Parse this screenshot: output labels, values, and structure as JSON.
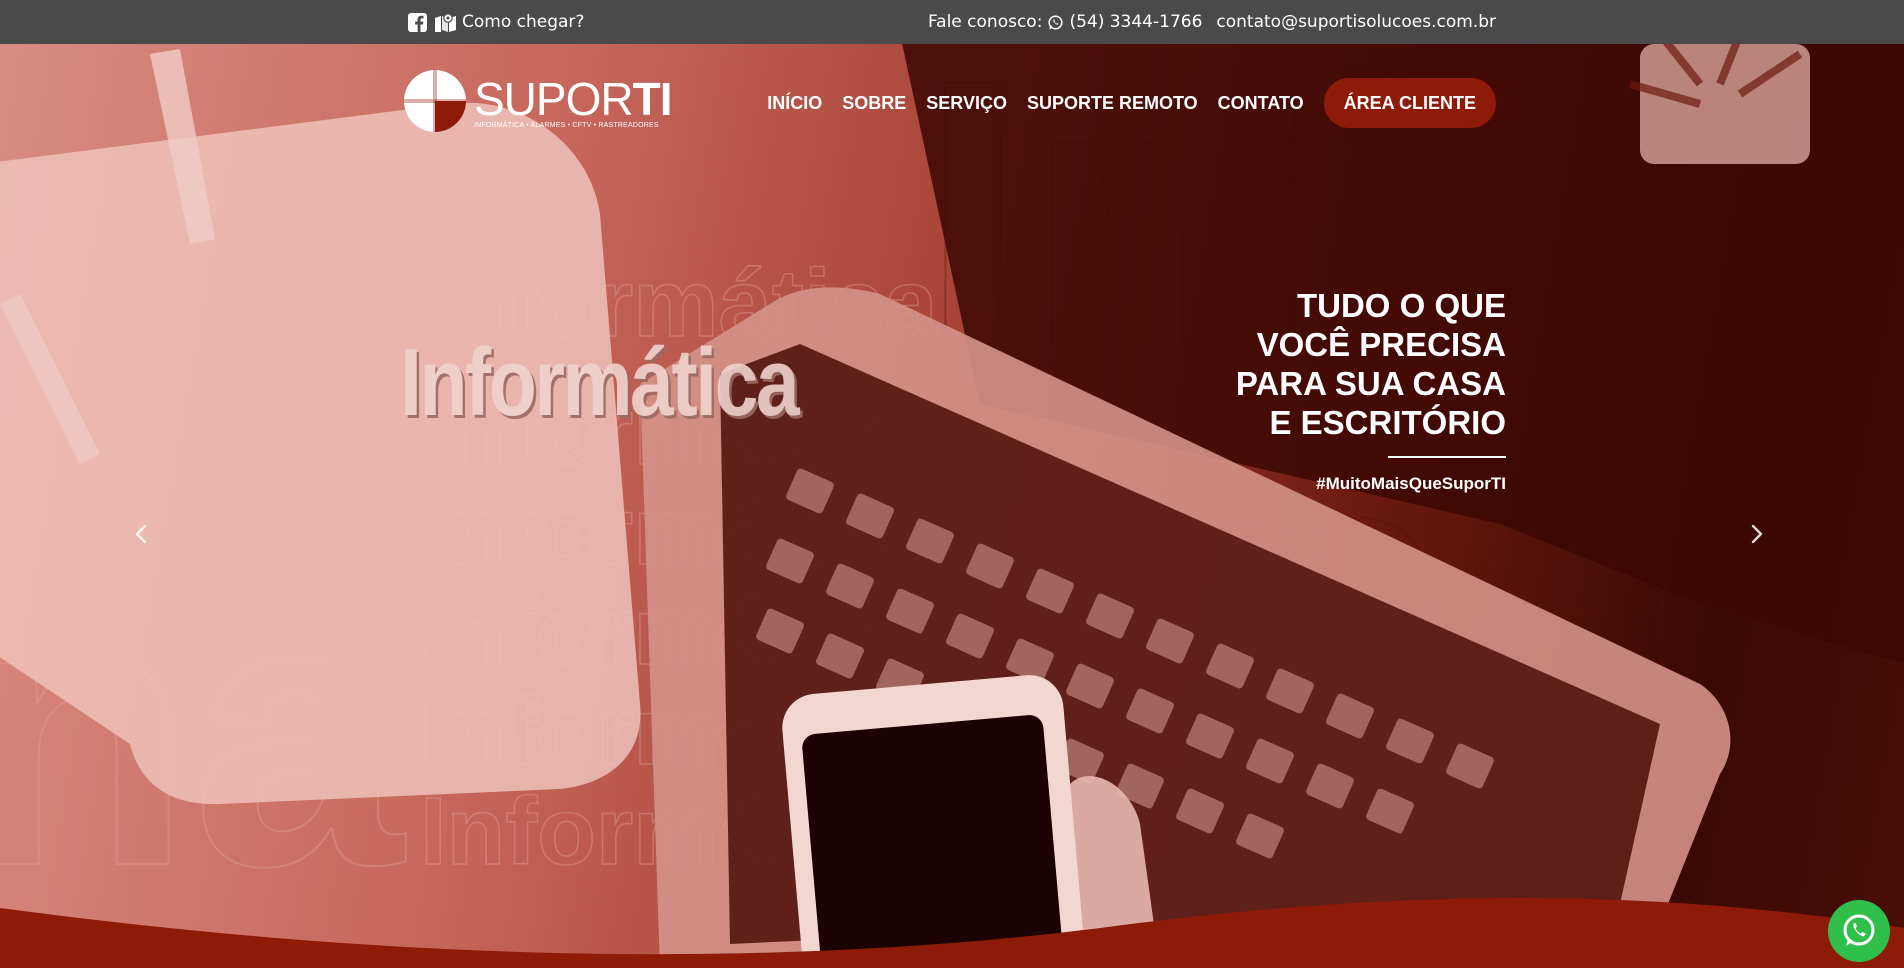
{
  "topbar": {
    "left_icons": [
      "facebook-icon",
      "map-icon"
    ],
    "directions_label": "Como chegar?",
    "contact_prefix": "Fale conosco:",
    "phone": "(54) 3344-1766",
    "email": "contato@suportisolucoes.com.br"
  },
  "brand": {
    "name_light": "SUPOR",
    "name_bold": "TI",
    "tagline": "INFORMÁTICA • ALARMES • CFTV • RASTREADORES"
  },
  "nav": {
    "items": [
      "INÍCIO",
      "SOBRE",
      "SERVIÇO",
      "SUPORTE REMOTO",
      "CONTATO"
    ],
    "cta": "ÁREA CLIENTE"
  },
  "hero": {
    "headline_lines": [
      "TUDO O QUE",
      "VOCÊ PRECISA",
      "PARA SUA CASA",
      "E ESCRITÓRIO"
    ],
    "hashtag": "#MuitoMaisQueSuporTI",
    "image_word": "Informática",
    "prev_icon": "chevron-left-icon",
    "next_icon": "chevron-right-icon"
  },
  "colors": {
    "topbar": "#4a4a4a",
    "accent": "#8e1a08",
    "whatsapp": "#2fbf4a"
  }
}
